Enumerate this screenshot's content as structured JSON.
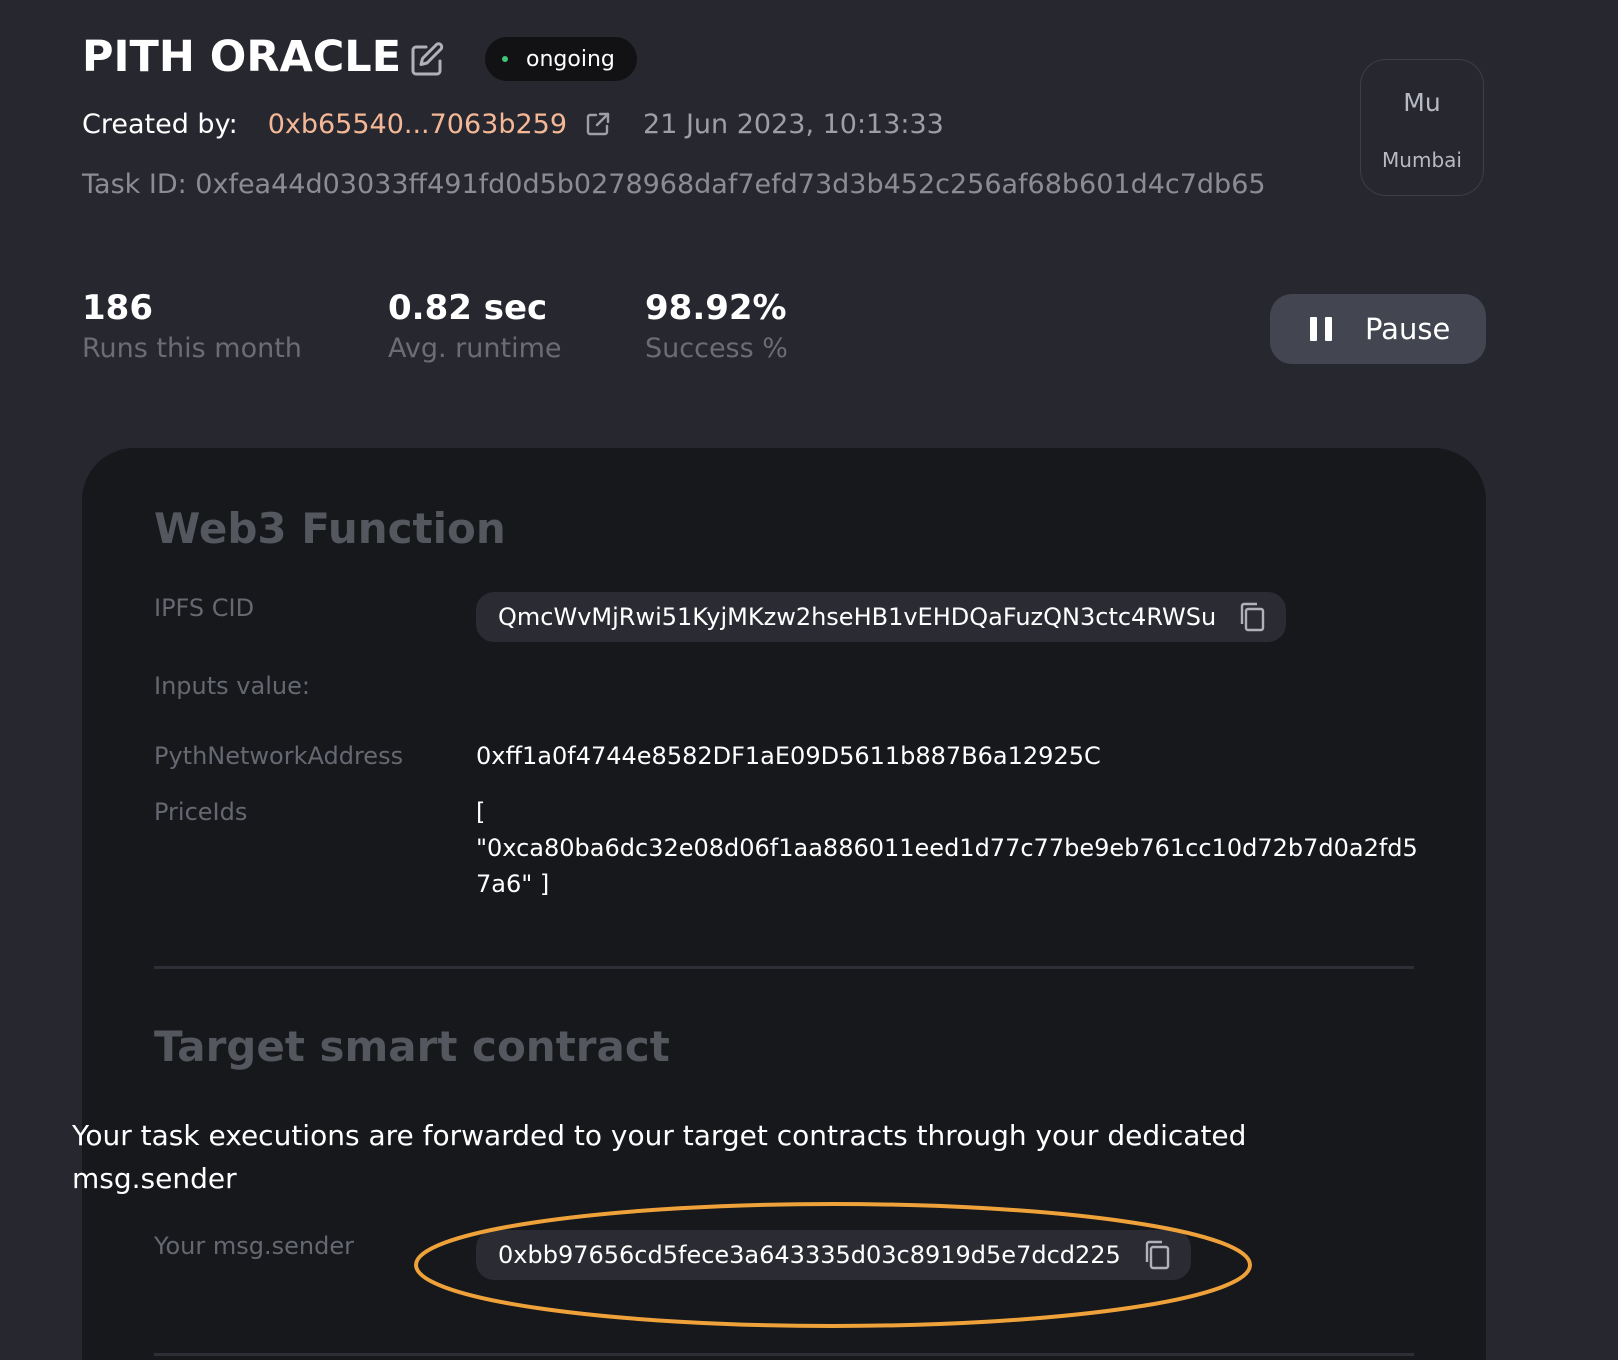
{
  "header": {
    "title": "PITH ORACLE",
    "status": "ongoing",
    "created_label": "Created by:",
    "creator_address": "0xb65540...7063b259",
    "created_date": "21 Jun 2023, 10:13:33",
    "task_id": "Task ID: 0xfea44d03033ff491fd0d5b0278968daf7efd73d3b452c256af68b601d4c7db65"
  },
  "network": {
    "short": "Mu",
    "name": "Mumbai"
  },
  "stats": [
    {
      "value": "186",
      "label": "Runs this month"
    },
    {
      "value": "0.82 sec",
      "label": "Avg. runtime"
    },
    {
      "value": "98.92%",
      "label": "Success %"
    }
  ],
  "pause_button": {
    "label": "Pause"
  },
  "web3_function": {
    "title": "Web3 Function",
    "ipfs_label": "IPFS CID",
    "ipfs_cid": "QmcWvMjRwi51KyjMKzw2hseHB1vEHDQaFuzQN3ctc4RWSu",
    "inputs_label": "Inputs value:",
    "inputs": [
      {
        "name": "PythNetworkAddress",
        "value": "0xff1a0f4744e8582DF1aE09D5611b887B6a12925C"
      },
      {
        "name": "PriceIds",
        "value_lines": [
          "[",
          "\"0xca80ba6dc32e08d06f1aa886011eed1d77c77be9eb761cc10d72b7d0a2fd5",
          "7a6\" ]"
        ]
      }
    ]
  },
  "target_contract": {
    "title": "Target smart contract",
    "description": "Your task executions are forwarded to your target contracts through your dedicated msg.sender",
    "sender_label": "Your msg.sender",
    "sender_address": "0xbb97656cd5fece3a643335d03c8919d5e7dcd225"
  },
  "colors": {
    "background": "#27272f",
    "panel": "#17181c",
    "accent_address": "#f5b897",
    "status_dot": "#3fc47a",
    "highlight": "#f0a23a"
  }
}
